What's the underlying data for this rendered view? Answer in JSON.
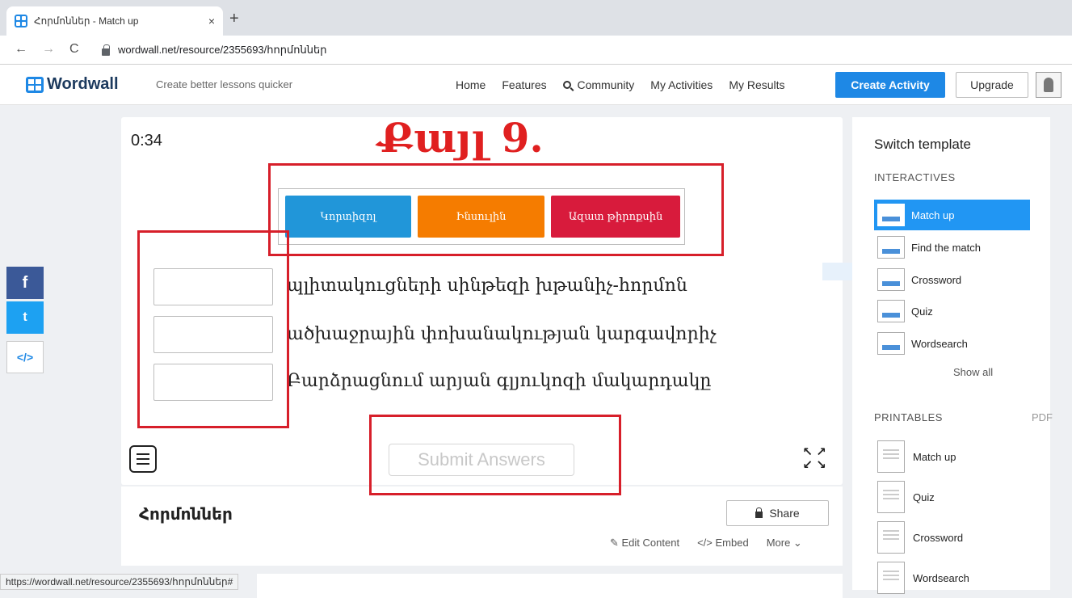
{
  "browser": {
    "tab_title": "Հորմոններ - Match up",
    "tab_close": "×",
    "new_tab": "+",
    "url": "wordwall.net/resource/2355693/հորմոններ",
    "status_url": "https://wordwall.net/resource/2355693/հորմոններ#"
  },
  "header": {
    "logo": "Wordwall",
    "tagline": "Create better lessons quicker",
    "nav": [
      "Home",
      "Features",
      "Community",
      "My Activities",
      "My Results"
    ],
    "create_activity": "Create Activity",
    "upgrade": "Upgrade"
  },
  "social": {
    "facebook": "f",
    "twitter": "t",
    "embed": "</>"
  },
  "activity": {
    "timer": "0:34",
    "step_label": "Քայլ 9.",
    "options": [
      "Կորտիզոլ",
      "Ինսուլին",
      "Ազատ թիրոքսին"
    ],
    "items": [
      "պլիտակուցների սինթեզի խթանիչ-հորմոն",
      "ածխաջրային փոխանակության կարգավորիչ",
      "Բարձրացնում արյան գլյուկոզի մակարդակը"
    ],
    "submit": "Submit Answers",
    "title": "Հորմոններ",
    "share": "Share",
    "edit_content": "Edit Content",
    "embed": "Embed",
    "more": "More"
  },
  "panel": {
    "title": "Switch template",
    "interactives_label": "INTERACTIVES",
    "interactives": [
      "Match up",
      "Find the match",
      "Crossword",
      "Quiz",
      "Wordsearch"
    ],
    "show_all": "Show all",
    "printables_label": "PRINTABLES",
    "pdf": "PDF",
    "printables": [
      "Match up",
      "Quiz",
      "Crossword",
      "Wordsearch"
    ]
  },
  "colors": {
    "accent": "#1e88e5",
    "option1": "#2196d9",
    "option2": "#f57c00",
    "option3": "#d81b3c",
    "annotation": "#d71f2a"
  }
}
